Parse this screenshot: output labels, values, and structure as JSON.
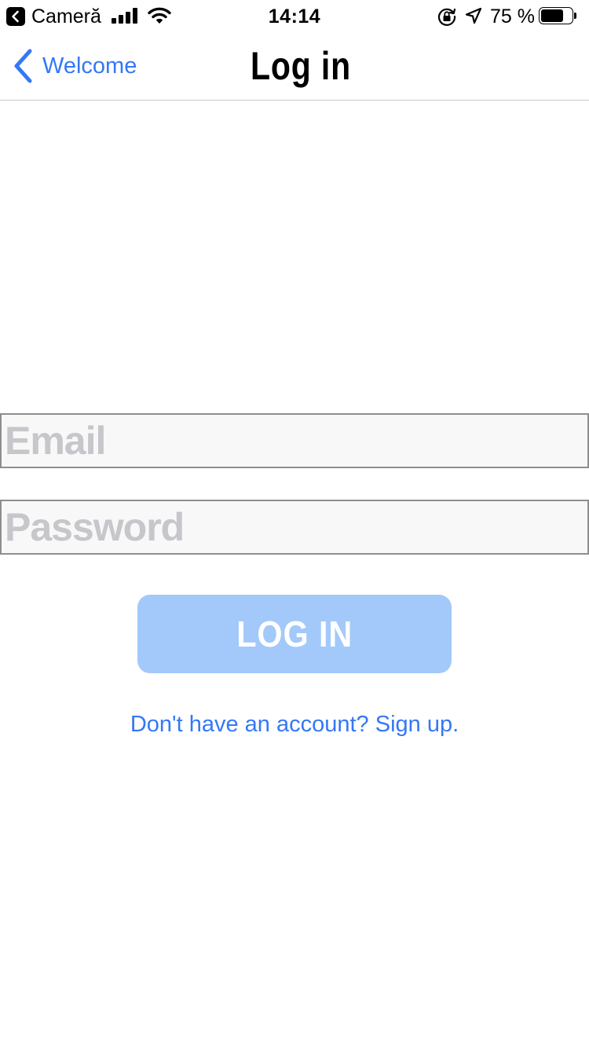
{
  "status_bar": {
    "carrier": "Cameră",
    "time": "14:14",
    "battery": "75 %",
    "battery_level": 0.75,
    "icons": [
      "back-to-app-icon",
      "cellular-signal-icon",
      "wifi-icon",
      "rotation-lock-icon",
      "location-arrow-icon",
      "battery-icon"
    ]
  },
  "nav": {
    "back_label": "Welcome",
    "title": "Log in"
  },
  "form": {
    "email_placeholder": "Email",
    "email_value": "",
    "password_placeholder": "Password",
    "password_value": "",
    "login_label": "LOG IN",
    "signup_text": "Don't have an account? Sign up."
  },
  "colors": {
    "accent": "#3478f6",
    "button_bg": "#a3c9fa",
    "field_bg": "#f8f8f8",
    "field_border": "#8e8e8e",
    "placeholder": "#c6c6cb"
  }
}
